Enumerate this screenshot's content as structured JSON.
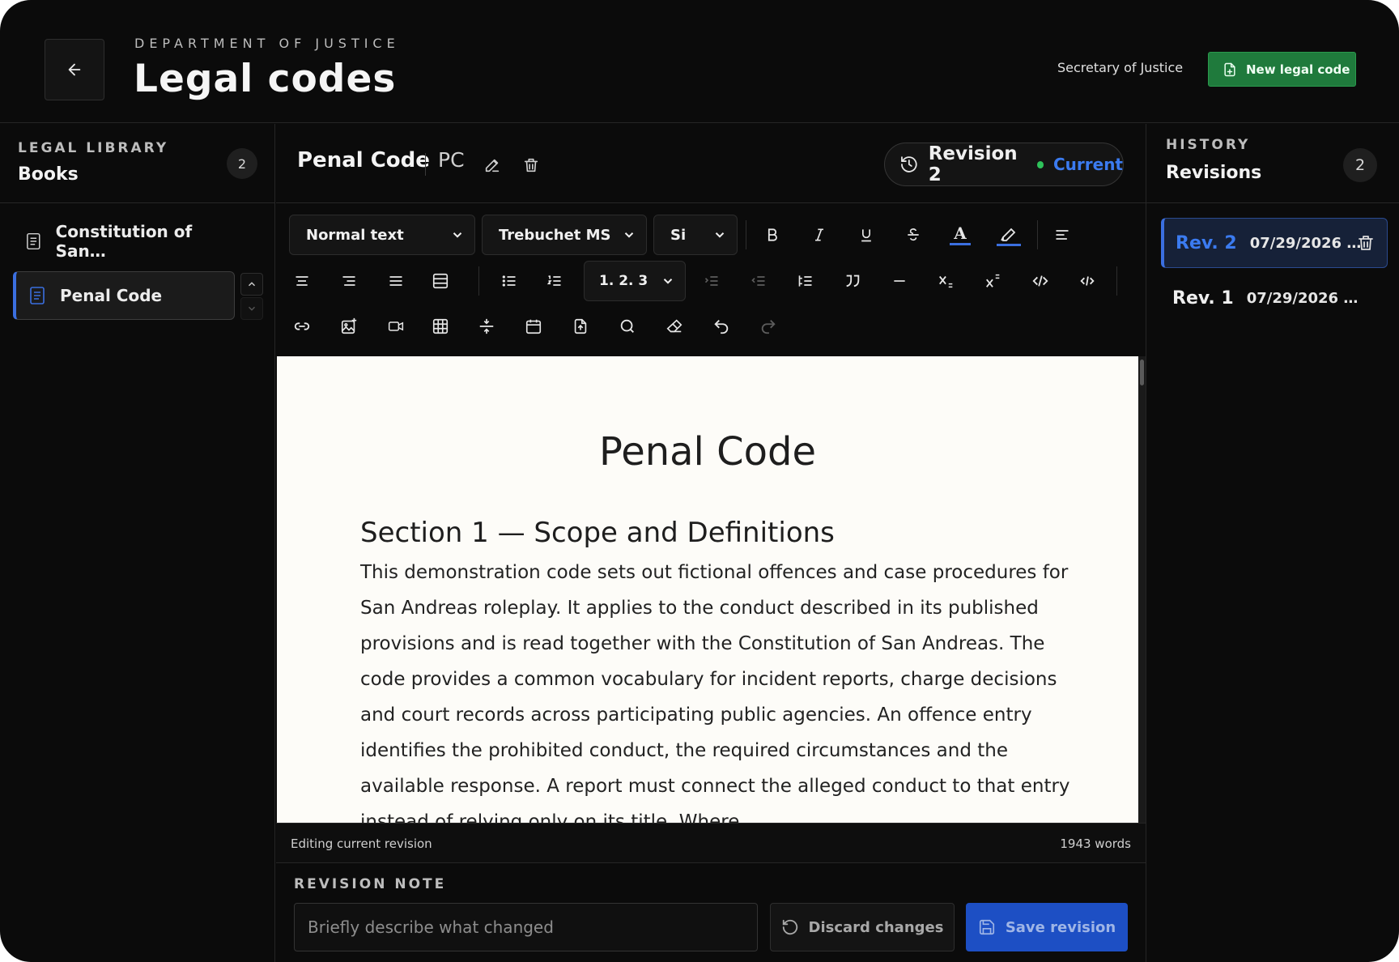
{
  "header": {
    "eyebrow": "DEPARTMENT OF JUSTICE",
    "title": "Legal codes",
    "user_role": "Secretary of Justice",
    "new_button": "New legal code"
  },
  "library": {
    "eyebrow": "LEGAL LIBRARY",
    "title": "Books",
    "count": "2",
    "items": [
      {
        "label": "Constitution of San…",
        "active": false
      },
      {
        "label": "Penal Code",
        "active": true
      }
    ]
  },
  "document": {
    "title": "Penal Code",
    "code": "PC",
    "revision_label": "Revision 2",
    "revision_status": "Current"
  },
  "toolbar": {
    "block_style": "Normal text",
    "font_family": "Trebuchet MS",
    "font_size": "Si",
    "list_style": "1. 2. 3"
  },
  "content": {
    "heading": "Penal Code",
    "section_heading": "Section 1 — Scope and Definitions",
    "body": "This demonstration code sets out fictional offences and case procedures for San Andreas roleplay. It applies to the conduct described in its published provisions and is read together with the Constitution of San Andreas. The code provides a common vocabulary for incident reports, charge decisions and court records across participating public agencies. An offence entry identifies the prohibited conduct, the required circumstances and the available response. A report must connect the alleged conduct to that entry instead of relying only on its title. Where"
  },
  "statusbar": {
    "mode": "Editing current revision",
    "word_count": "1943 words"
  },
  "revision_note": {
    "label": "REVISION NOTE",
    "placeholder": "Briefly describe what changed",
    "discard": "Discard changes",
    "save": "Save revision"
  },
  "history": {
    "eyebrow": "HISTORY",
    "title": "Revisions",
    "count": "2",
    "items": [
      {
        "number": "Rev. 2",
        "date": "07/29/2026 …",
        "active": true
      },
      {
        "number": "Rev. 1",
        "date": "07/29/2026 …",
        "active": false
      }
    ]
  },
  "colors": {
    "accent": "#3b6fe0",
    "success": "#1f7a3c",
    "background": "#0b0b0b",
    "paper": "#fdfcf8"
  }
}
